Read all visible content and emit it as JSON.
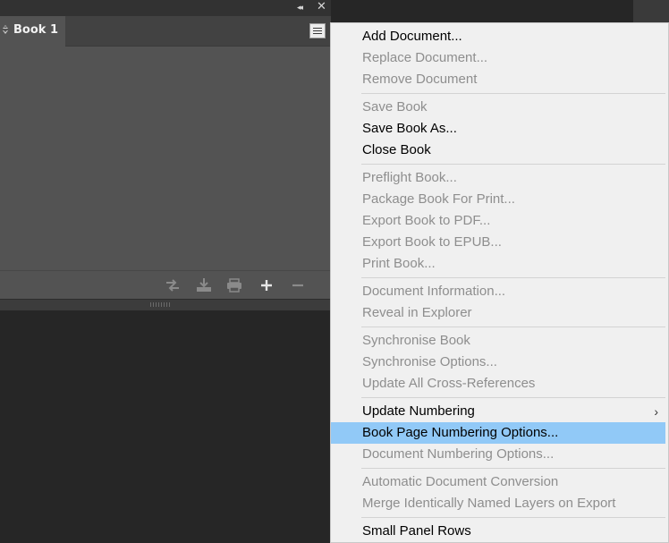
{
  "panel": {
    "tab_label": "Book 1",
    "collapse_glyph": "◂◂",
    "close_glyph": "✕",
    "footer_icons": [
      "synchronize-icon",
      "save-book-icon",
      "print-book-icon",
      "add-document-icon",
      "remove-document-icon"
    ]
  },
  "menu": {
    "groups": [
      [
        {
          "label": "Add Document...",
          "enabled": true
        },
        {
          "label": "Replace Document...",
          "enabled": false
        },
        {
          "label": "Remove Document",
          "enabled": false
        }
      ],
      [
        {
          "label": "Save Book",
          "enabled": false
        },
        {
          "label": "Save Book As...",
          "enabled": true
        },
        {
          "label": "Close Book",
          "enabled": true
        }
      ],
      [
        {
          "label": "Preflight Book...",
          "enabled": false
        },
        {
          "label": "Package Book For Print...",
          "enabled": false
        },
        {
          "label": "Export Book to PDF...",
          "enabled": false
        },
        {
          "label": "Export Book to EPUB...",
          "enabled": false
        },
        {
          "label": "Print Book...",
          "enabled": false
        }
      ],
      [
        {
          "label": "Document Information...",
          "enabled": false
        },
        {
          "label": "Reveal in Explorer",
          "enabled": false
        }
      ],
      [
        {
          "label": "Synchronise Book",
          "enabled": false
        },
        {
          "label": "Synchronise Options...",
          "enabled": false
        },
        {
          "label": "Update All Cross-References",
          "enabled": false
        }
      ],
      [
        {
          "label": "Update Numbering",
          "enabled": true,
          "submenu": true
        },
        {
          "label": "Book Page Numbering Options...",
          "enabled": true,
          "highlighted": true
        },
        {
          "label": "Document Numbering Options...",
          "enabled": false
        }
      ],
      [
        {
          "label": "Automatic Document Conversion",
          "enabled": false
        },
        {
          "label": "Merge Identically Named Layers on Export",
          "enabled": false
        }
      ],
      [
        {
          "label": "Small Panel Rows",
          "enabled": true
        }
      ]
    ]
  },
  "colors": {
    "highlight": "#91c9f7",
    "disabled_text": "#8e8e8e",
    "menu_bg": "#f0f0f0",
    "panel_bg": "#535353",
    "app_bg": "#262626"
  }
}
